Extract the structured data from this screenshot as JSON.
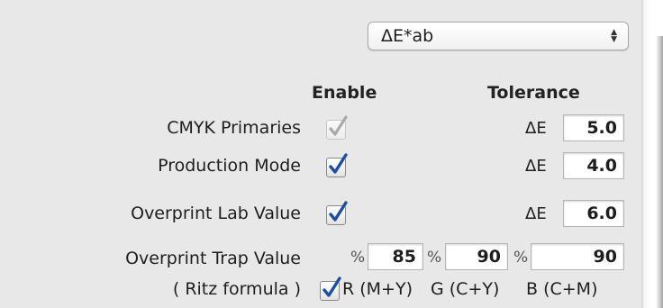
{
  "metric_select": {
    "value": "ΔE*ab",
    "arrows": "⌃⌄"
  },
  "headers": {
    "enable": "Enable",
    "tolerance": "Tolerance"
  },
  "rows": [
    {
      "label": "CMYK Primaries",
      "enabled": true,
      "disabled": true,
      "delta": "ΔE",
      "tolerance": "5.0"
    },
    {
      "label": "Production Mode",
      "enabled": true,
      "disabled": false,
      "delta": "ΔE",
      "tolerance": "4.0"
    },
    {
      "label": "Overprint Lab Value",
      "enabled": true,
      "disabled": false,
      "delta": "ΔE",
      "tolerance": "6.0"
    }
  ],
  "trap": {
    "label": "Overprint Trap Value",
    "sublabel": "( Ritz formula )",
    "percent_symbol": "%",
    "values": [
      "85",
      "90",
      "90"
    ],
    "channels": [
      "R (M+Y)",
      "G (C+Y)",
      "B (C+M)"
    ],
    "enabled": true
  },
  "colors": {
    "check": "#1f4f9c",
    "check_disabled": "#a9a9a9"
  }
}
